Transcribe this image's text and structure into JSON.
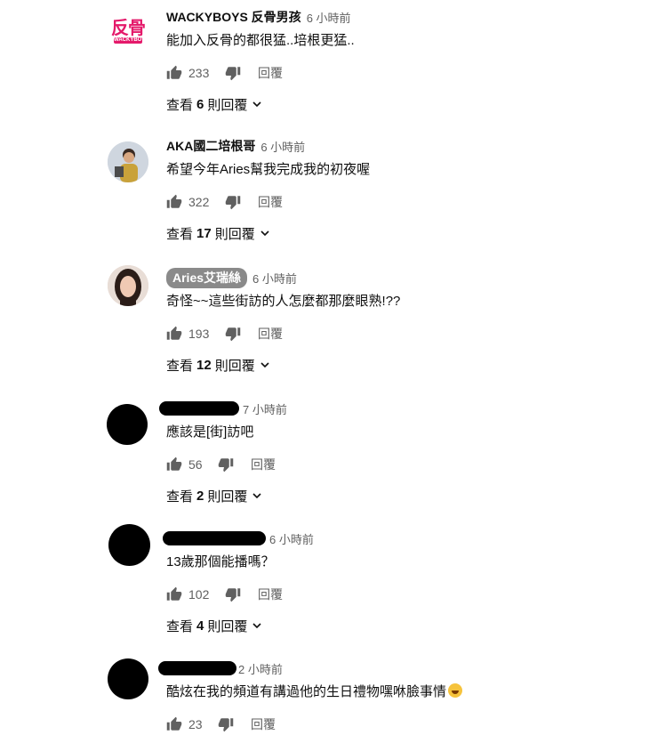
{
  "comments": [
    {
      "author": "WACKYBOYS 反骨男孩",
      "avatar": {
        "type": "logo",
        "text": "反骨",
        "sub": "WACKYBOYS",
        "color": "#e4196a"
      },
      "time": "6 小時前",
      "text": "能加入反骨的都很猛..培根更猛..",
      "likes": "233",
      "reply_label": "回覆",
      "view_prefix": "查看",
      "view_count": "6",
      "view_suffix": "則回覆"
    },
    {
      "author": "AKA國二培根哥",
      "avatar": {
        "type": "photo"
      },
      "time": "6 小時前",
      "text": "希望今年Aries幫我完成我的初夜喔",
      "likes": "322",
      "reply_label": "回覆",
      "view_prefix": "查看",
      "view_count": "17",
      "view_suffix": "則回覆"
    },
    {
      "author": "Aries艾瑞絲",
      "avatar": {
        "type": "photo"
      },
      "time": "6 小時前",
      "text": "奇怪~~這些街訪的人怎麼都那麼眼熟!??",
      "likes": "193",
      "reply_label": "回覆",
      "view_prefix": "查看",
      "view_count": "12",
      "view_suffix": "則回覆"
    },
    {
      "author": "",
      "avatar": {
        "type": "redacted"
      },
      "time": "7 小時前",
      "text": "應該是[街]訪吧",
      "likes": "56",
      "reply_label": "回覆",
      "view_prefix": "查看",
      "view_count": "2",
      "view_suffix": "則回覆"
    },
    {
      "author": "",
      "avatar": {
        "type": "redacted"
      },
      "time": "6 小時前",
      "text": "13歲那個能播嗎？",
      "likes": "102",
      "reply_label": "回覆",
      "view_prefix": "查看",
      "view_count": "4",
      "view_suffix": "則回覆"
    },
    {
      "author": "",
      "avatar": {
        "type": "redacted"
      },
      "time": "2 小時前",
      "text": "酷炫在我的頻道有講過他的生日禮物嘿咻臉事情",
      "emoji": "grinning-sweat-emoji",
      "likes": "23",
      "reply_label": "回覆"
    }
  ],
  "icons": {
    "like": "thumbs-up-icon",
    "dislike": "thumbs-down-icon",
    "expand": "chevron-down-icon"
  },
  "colors": {
    "brand_pink": "#e4196a",
    "secondary_text": "#606060",
    "owner_badge": "#8a8a8a"
  }
}
